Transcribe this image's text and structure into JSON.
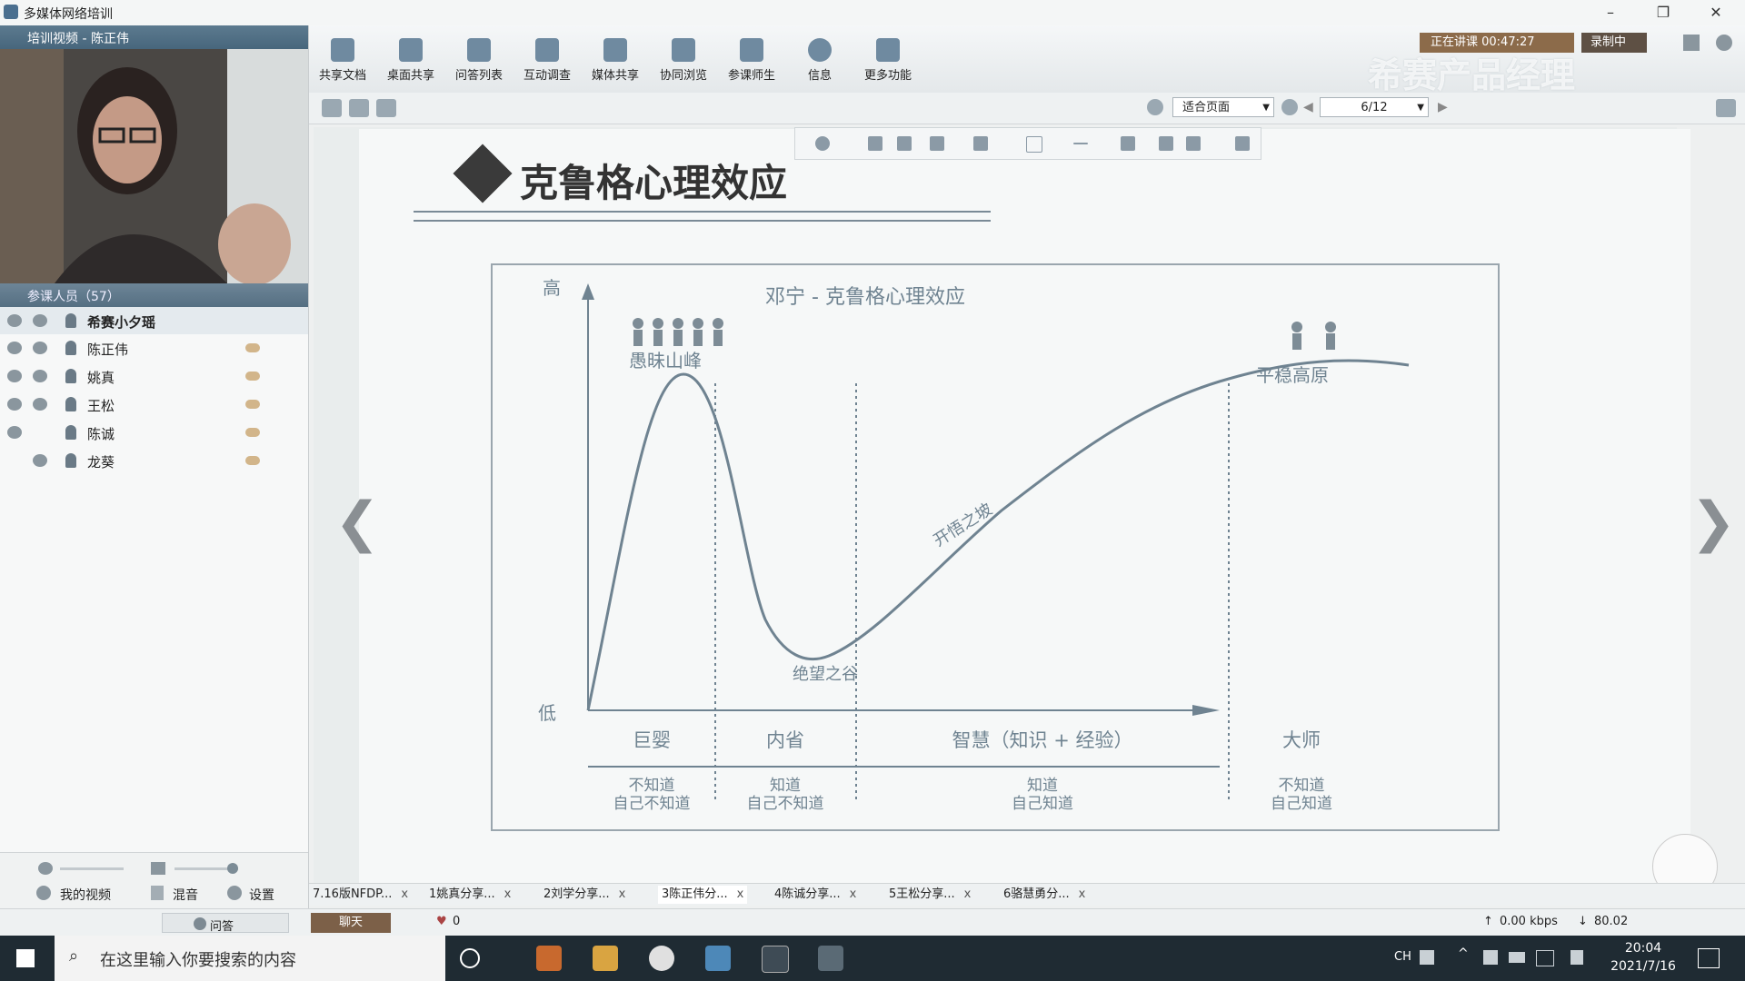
{
  "window": {
    "title": "多媒体网络培训"
  },
  "video_panel": {
    "header": "培训视频 - 陈正伟"
  },
  "participants": {
    "header": "参课人员（57）",
    "list": [
      {
        "name": "希赛小夕瑶"
      },
      {
        "name": "陈正伟"
      },
      {
        "name": "姚真"
      },
      {
        "name": "王松"
      },
      {
        "name": "陈诚"
      },
      {
        "name": "龙葵"
      }
    ]
  },
  "left_bottom": {
    "my_video": "我的视频",
    "mix": "混音",
    "settings": "设置",
    "qa": "问答"
  },
  "toolbar": {
    "items": [
      "共享文档",
      "桌面共享",
      "问答列表",
      "互动调查",
      "媒体共享",
      "协同浏览",
      "参课师生",
      "信息",
      "更多功能"
    ]
  },
  "status_top": {
    "lecture": "正在讲课 00:47:27",
    "record": "录制中"
  },
  "watermark": "希赛产品经理",
  "viewer": {
    "fit": "适合页面",
    "page": "6/12"
  },
  "slide": {
    "title": "克鲁格心理效应"
  },
  "chart_data": {
    "type": "line",
    "title": "邓宁 - 克鲁格心理效应",
    "ylabel_high": "高",
    "ylabel_low": "低",
    "annotations": [
      "愚昧山峰",
      "绝望之谷",
      "开悟之坡",
      "平稳高原"
    ],
    "stages": [
      "巨婴",
      "内省",
      "智慧（知识 + 经验）",
      "大师"
    ],
    "stage_desc": [
      [
        "不知道",
        "自己不知道"
      ],
      [
        "知道",
        "自己不知道"
      ],
      [
        "知道",
        "自己知道"
      ],
      [
        "不知道",
        "自己知道"
      ]
    ]
  },
  "tabs": [
    {
      "label": "7.16版NFDP..."
    },
    {
      "label": "1姚真分享..."
    },
    {
      "label": "2刘学分享..."
    },
    {
      "label": "3陈正伟分..."
    },
    {
      "label": "4陈诚分享..."
    },
    {
      "label": "5王松分享..."
    },
    {
      "label": "6骆慧勇分..."
    }
  ],
  "statusbar": {
    "chat": "聊天",
    "likes": "0",
    "up": "0.00 kbps",
    "down": "80.02"
  },
  "taskbar": {
    "search_placeholder": "在这里输入你要搜索的内容",
    "lang": "CH",
    "time": "20:04",
    "date": "2021/7/16"
  }
}
